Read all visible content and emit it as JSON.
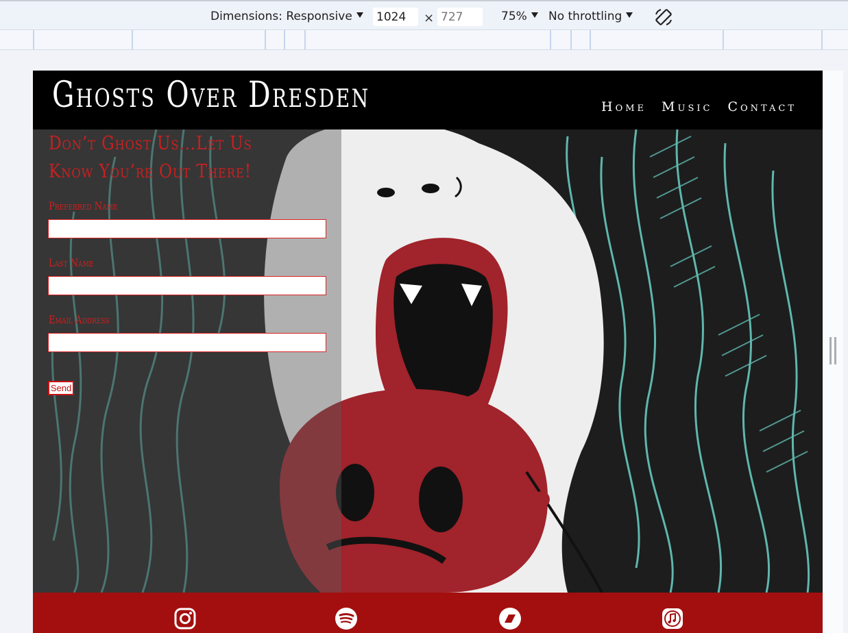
{
  "devtools": {
    "dimensions_label": "Dimensions: Responsive",
    "width_value": "1024",
    "height_placeholder": "727",
    "times": "×",
    "zoom_label": "75%",
    "throttling_label": "No throttling",
    "rotate_icon": "rotate-icon"
  },
  "site": {
    "title": "Ghosts Over Dresden",
    "nav": [
      "Home",
      "Music",
      "Contact"
    ]
  },
  "form": {
    "heading": "Don’t Ghost Us...Let Us Know You’re Out There!",
    "fields": [
      {
        "label": "Preferred Name",
        "value": ""
      },
      {
        "label": "Last Name",
        "value": ""
      },
      {
        "label": "Email Address",
        "value": ""
      }
    ],
    "submit_label": "Send"
  },
  "footer": {
    "socials": [
      "instagram-icon",
      "spotify-icon",
      "bandcamp-icon",
      "itunes-icon"
    ]
  },
  "colors": {
    "accent_red": "#cc1f1f",
    "footer_red": "#a30f0f",
    "teal": "#5fb7ad"
  }
}
